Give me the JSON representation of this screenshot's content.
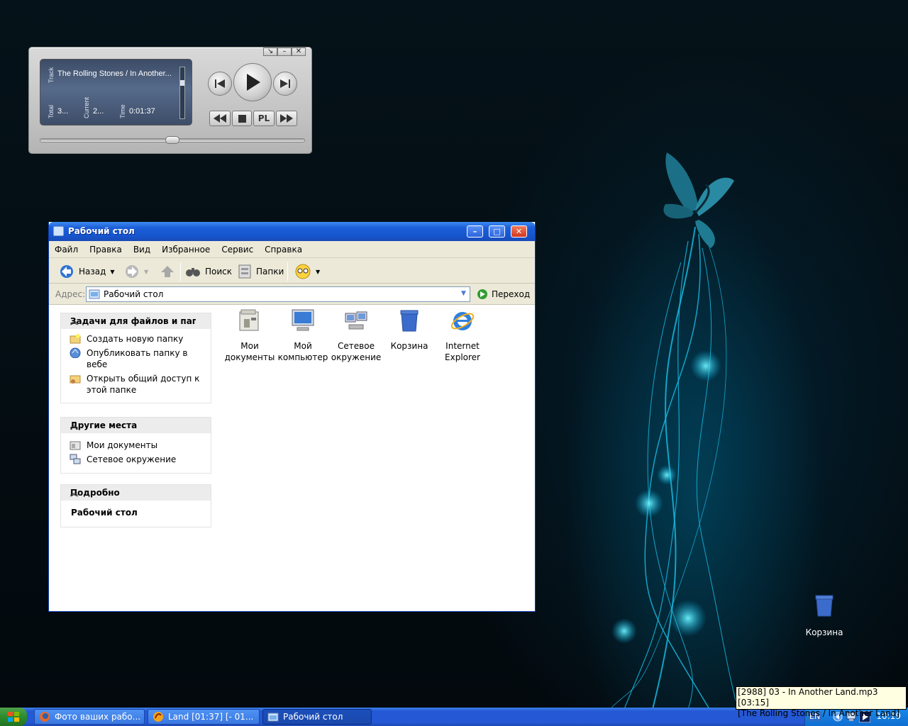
{
  "player": {
    "track_label": "Track",
    "track_title": "The Rolling Stones / In Another...",
    "total_label": "Total",
    "total_value": "3...",
    "current_label": "Current",
    "current_value": "2...",
    "time_label": "Time",
    "time_value": "0:01:37",
    "pl_label": "PL",
    "seek_position": 0.5
  },
  "window": {
    "title": "Рабочий стол",
    "menu": [
      "Файл",
      "Правка",
      "Вид",
      "Избранное",
      "Сервис",
      "Справка"
    ],
    "toolbar": {
      "back_label": "Назад",
      "search_label": "Поиск",
      "folders_label": "Папки"
    },
    "address": {
      "label": "Адрес:",
      "value": "Рабочий стол",
      "go_label": "Переход"
    },
    "tasks": {
      "title": "Задачи для файлов и папок",
      "items": [
        "Создать новую папку",
        "Опубликовать папку в вебе",
        "Открыть общий доступ к этой папке"
      ]
    },
    "places": {
      "title": "Другие места",
      "items": [
        "Мои документы",
        "Сетевое окружение"
      ]
    },
    "details": {
      "title": "Подробно",
      "name": "Рабочий стол"
    },
    "files": [
      {
        "label": "Мои документы",
        "icon": "my-documents-icon"
      },
      {
        "label": "Мой компьютер",
        "icon": "my-computer-icon"
      },
      {
        "label": "Сетевое окружение",
        "icon": "network-icon"
      },
      {
        "label": "Корзина",
        "icon": "recycle-bin-icon"
      },
      {
        "label": "Internet Explorer",
        "icon": "ie-icon"
      }
    ]
  },
  "desktop": {
    "recycle_label": "Корзина"
  },
  "tooltip": {
    "line1": "[2988] 03 - In Another Land.mp3 [03:15]",
    "line2": "[The Rolling Stones / In Another Land]"
  },
  "taskbar": {
    "tasks": [
      {
        "label": "Фото ваших рабо...",
        "icon": "firefox-icon"
      },
      {
        "label": "Land [01:37] [- 01...",
        "icon": "player-icon"
      },
      {
        "label": "Рабочий стол",
        "icon": "folder-icon"
      }
    ],
    "lang": "EN",
    "clock": "10:19"
  },
  "colors": {
    "titlebar": "#1d5fd8",
    "taskbar": "#2458d5",
    "start": "#2c8c2c",
    "tray": "#0f6ed2"
  }
}
